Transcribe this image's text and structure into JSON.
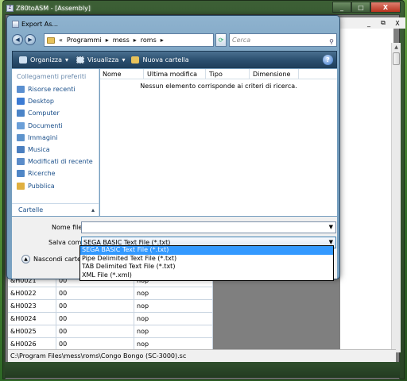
{
  "app": {
    "title": "Z80toASM - [Assembly]"
  },
  "dialog": {
    "title": "Export As...",
    "breadcrumb": [
      "«",
      "Programmi",
      "mess",
      "roms"
    ],
    "search_placeholder": "Cerca",
    "toolbar": {
      "organize": "Organizza",
      "views": "Visualizza",
      "new_folder": "Nuova cartella",
      "help": "?"
    },
    "favorites_header": "Collegamenti preferiti",
    "favorites": [
      {
        "label": "Risorse recenti",
        "icon": "recent-places-icon",
        "color": "#5a8fd0"
      },
      {
        "label": "Desktop",
        "icon": "desktop-icon",
        "color": "#3b7bd4"
      },
      {
        "label": "Computer",
        "icon": "computer-icon",
        "color": "#4a84c8"
      },
      {
        "label": "Documenti",
        "icon": "documents-icon",
        "color": "#6a9fd8"
      },
      {
        "label": "Immagini",
        "icon": "pictures-icon",
        "color": "#5d93cc"
      },
      {
        "label": "Musica",
        "icon": "music-icon",
        "color": "#4a7fc0"
      },
      {
        "label": "Modificati di recente",
        "icon": "recently-changed-icon",
        "color": "#5b8cc9"
      },
      {
        "label": "Ricerche",
        "icon": "searches-icon",
        "color": "#4f86c6"
      },
      {
        "label": "Pubblica",
        "icon": "public-folder-icon",
        "color": "#e0b040"
      }
    ],
    "folders_label": "Cartelle",
    "columns": [
      "Nome",
      "Ultima modifica",
      "Tipo",
      "Dimensione"
    ],
    "empty_message": "Nessun elemento corrisponde ai criteri di ricerca.",
    "filename_label": "Nome file:",
    "filename_value": "",
    "save_as_label": "Salva come:",
    "save_as_value": "SEGA BASIC Text File (*.txt)",
    "hide_folders_label": "Nascondi cartelle",
    "save_as_options": [
      {
        "label": "SEGA BASIC Text File (*.txt)",
        "selected": true
      },
      {
        "label": "Pipe Delimited Text File (*.txt)",
        "selected": false
      },
      {
        "label": "TAB Delimited Text File (*.txt)",
        "selected": false
      },
      {
        "label": "XML File (*.xml)",
        "selected": false
      }
    ]
  },
  "grid": {
    "rows": [
      [
        "&H0021",
        "00",
        "nop"
      ],
      [
        "&H0022",
        "00",
        "nop"
      ],
      [
        "&H0023",
        "00",
        "nop"
      ],
      [
        "&H0024",
        "00",
        "nop"
      ],
      [
        "&H0025",
        "00",
        "nop"
      ],
      [
        "&H0026",
        "00",
        "nop"
      ]
    ]
  },
  "status": {
    "path": "C:\\Program Files\\mess\\roms\\Congo Bongo (SC-3000).sc"
  },
  "window_buttons": {
    "minimize": "_",
    "maximize": "□",
    "close": "X",
    "mdi_minimize": "_",
    "mdi_restore": "⧉",
    "mdi_close": "X"
  }
}
